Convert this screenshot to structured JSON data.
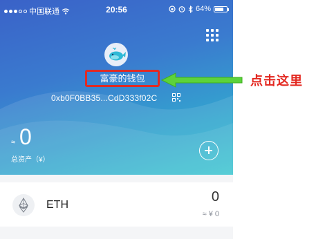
{
  "status_bar": {
    "carrier": "中国联通",
    "time": "20:56",
    "battery": "64%"
  },
  "wallet": {
    "name": "富豪的钱包",
    "address": "0xb0F0BB35...CdD333f02C",
    "approx_symbol": "≈",
    "balance": "0",
    "assets_label": "总资产（¥）"
  },
  "tokens": [
    {
      "symbol": "ETH",
      "amount": "0",
      "fiat": "≈ ¥ 0"
    }
  ],
  "annotation": {
    "label": "点击这里",
    "color": "#e3271f",
    "arrow_color": "#5cd33a"
  },
  "colors": {
    "gradient_top": "#3a62c8",
    "gradient_bottom": "#35c4cf"
  }
}
